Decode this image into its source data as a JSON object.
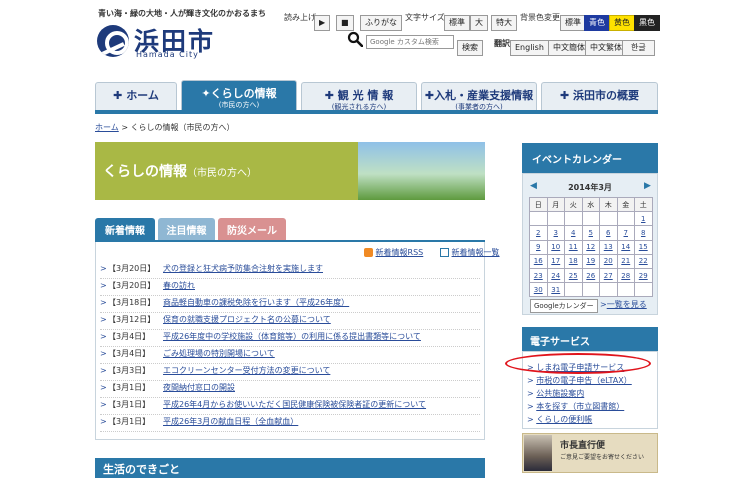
{
  "header": {
    "tagline": "青い海・緑の大地・人が輝き文化のかおるまち",
    "logo_text": "浜田市",
    "logo_sub": "Hamada City",
    "read_aloud_label": "読み上げ",
    "play_label": "▶",
    "stop_label": "■",
    "furigana_label": "ふりがな",
    "font_size_label": "文字サイズ",
    "font_sizes": [
      "標準",
      "大",
      "特大"
    ],
    "bg_color_label": "背景色変更",
    "bg_colors": [
      "標準",
      "青色",
      "黄色",
      "黒色"
    ],
    "search_placeholder": "Google カスタム検索",
    "search_button": "検索",
    "translate_label": "翻訳",
    "languages": [
      "English",
      "中文簡体",
      "中文繁体",
      "한글"
    ]
  },
  "nav": [
    {
      "label": "ホーム",
      "sub": ""
    },
    {
      "label": "くらしの情報",
      "sub": "(市民の方へ)"
    },
    {
      "label": "観 光 情 報",
      "sub": "(観光される方へ)"
    },
    {
      "label": "入札・産業支援情報",
      "sub": "(事業者の方へ)"
    },
    {
      "label": "浜田市の概要",
      "sub": ""
    }
  ],
  "breadcrumb": {
    "home": "ホーム",
    "sep": ">",
    "current": "くらしの情報（市民の方へ）"
  },
  "banner": {
    "title": "くらしの情報",
    "sub": "（市民の方へ）"
  },
  "tabs": [
    "新着情報",
    "注目情報",
    "防災メール"
  ],
  "news_links": {
    "rss": "新着情報RSS",
    "list": "新着情報一覧"
  },
  "news": [
    {
      "date": "【3月20日】",
      "title": "犬の登録と狂犬病予防集合注射を実施します"
    },
    {
      "date": "【3月20日】",
      "title": "春の訪れ"
    },
    {
      "date": "【3月18日】",
      "title": "商品軽自動車の課税免除を行います（平成26年度）"
    },
    {
      "date": "【3月12日】",
      "title": "保育の就職支援プロジェクト名の公募について"
    },
    {
      "date": "【3月4日】",
      "title": "平成26年度中の学校施設（体育館等）の利用に係る提出書類等について"
    },
    {
      "date": "【3月4日】",
      "title": "ごみ処理場の特別開場について"
    },
    {
      "date": "【3月3日】",
      "title": "エコクリーンセンター受付方法の変更について"
    },
    {
      "date": "【3月1日】",
      "title": "夜間納付窓口の開設"
    },
    {
      "date": "【3月1日】",
      "title": "平成26年4月からお使いいただく国民健康保険被保険者証の更新について"
    },
    {
      "date": "【3月1日】",
      "title": "平成26年3月の献血日程（全血献血）"
    }
  ],
  "bottom_bar": "生活のできごと",
  "calendar": {
    "title": "イベントカレンダー",
    "month": "2014年3月",
    "prev": "◀",
    "next": "▶",
    "weekdays": [
      "日",
      "月",
      "火",
      "水",
      "木",
      "金",
      "土"
    ],
    "weeks": [
      [
        "",
        "",
        "",
        "",
        "",
        "",
        "1"
      ],
      [
        "2",
        "3",
        "4",
        "5",
        "6",
        "7",
        "8"
      ],
      [
        "9",
        "10",
        "11",
        "12",
        "13",
        "14",
        "15"
      ],
      [
        "16",
        "17",
        "18",
        "19",
        "20",
        "21",
        "22"
      ],
      [
        "23",
        "24",
        "25",
        "26",
        "27",
        "28",
        "29"
      ],
      [
        "30",
        "31",
        "",
        "",
        "",
        "",
        ""
      ]
    ],
    "google_label": "Googleカレンダー",
    "list_link": "一覧を見る"
  },
  "e_services": {
    "title": "電子サービス",
    "items": [
      "しまね電子申請サービス",
      "市税の電子申告（eLTAX）",
      "公共施設案内",
      "本を探す（市立図書館）",
      "くらしの便利帳"
    ]
  },
  "mayor": {
    "title": "市長直行便",
    "sub": "ご意見ご要望をお寄せください"
  },
  "colors": {
    "brand_blue": "#1e3a7b",
    "tab_blue": "#2a78a8",
    "banner_green": "#a9b845",
    "highlight_red": "#e0141c"
  }
}
